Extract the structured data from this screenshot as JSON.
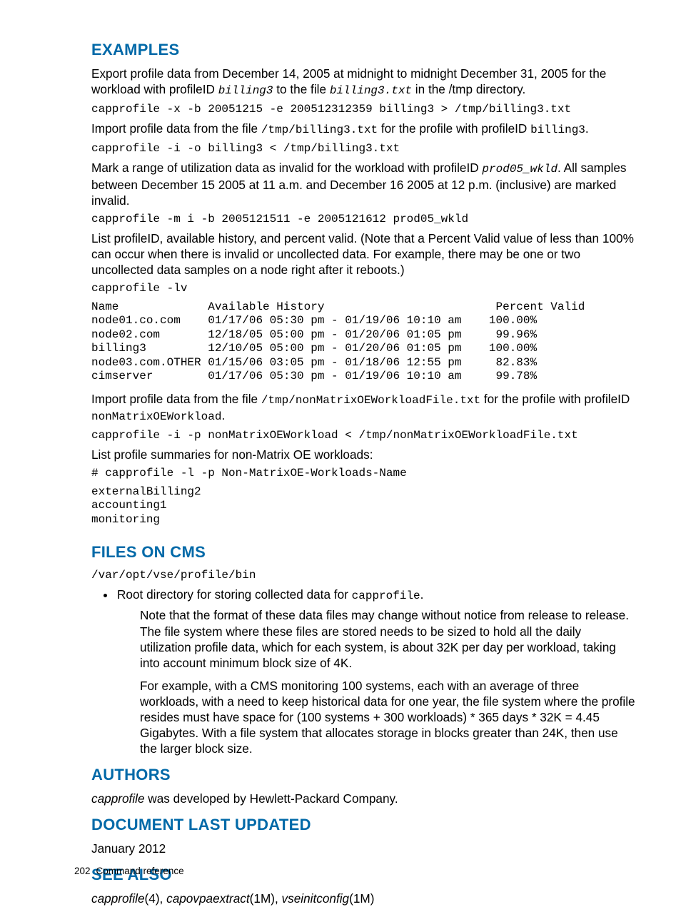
{
  "sections": {
    "examples": {
      "title": "EXAMPLES",
      "p1a": "Export profile data from December 14, 2005 at midnight to midnight December 31, 2005 for the workload with profileID ",
      "p1code1": "billing3",
      "p1b": " to the file ",
      "p1code2": "billing3.txt",
      "p1c": " in the /tmp directory.",
      "cmd1": "capprofile -x -b 20051215 -e 200512312359 billing3 > /tmp/billing3.txt",
      "p2a": "Import profile data from the file ",
      "p2code1": "/tmp/billing3.txt",
      "p2b": " for the profile with profileID ",
      "p2code2": "billing3",
      "p2c": ".",
      "cmd2": "capprofile -i -o billing3 < /tmp/billing3.txt",
      "p3a": "Mark a range of utilization data as invalid for the workload with profileID ",
      "p3code1": "prod05_wkld",
      "p3b": ". All samples between December 15 2005 at 11 a.m. and December 16 2005 at 12 p.m. (inclusive) are marked invalid.",
      "cmd3": "capprofile -m i -b 2005121511 -e 2005121612 prod05_wkld",
      "p4": "List profileID, available history, and percent valid. (Note that a Percent Valid value of less than 100% can occur when there is invalid or uncollected data. For example, there may be one or two uncollected data samples on a node right after it reboots.)",
      "cmd4": "capprofile -lv",
      "table": "Name             Available History                         Percent Valid\nnode01.co.com    01/17/06 05:30 pm - 01/19/06 10:10 am    100.00%\nnode02.com       12/18/05 05:00 pm - 01/20/06 01:05 pm     99.96%\nbilling3         12/10/05 05:00 pm - 01/20/06 01:05 pm    100.00%\nnode03.com.OTHER 01/15/06 03:05 pm - 01/18/06 12:55 pm     82.83%\ncimserver        01/17/06 05:30 pm - 01/19/06 10:10 am     99.78%",
      "p5a": "Import profile data from the file ",
      "p5code1": "/tmp/nonMatrixOEWorkloadFile.txt",
      "p5b": " for the profile with profileID ",
      "p5code2": "nonMatrixOEWorkload",
      "p5c": ".",
      "cmd5": "capprofile -i -p nonMatrixOEWorkload < /tmp/nonMatrixOEWorkloadFile.txt",
      "p6": "List profile summaries for non-Matrix OE workloads:",
      "cmd6": "# capprofile -l -p Non-MatrixOE-Workloads-Name",
      "out6": "externalBilling2\naccounting1\nmonitoring"
    },
    "files": {
      "title": "FILES ON CMS",
      "path": "/var/opt/vse/profile/bin",
      "li1a": "Root directory for storing collected data for ",
      "li1code": "capprofile",
      "li1b": ".",
      "sub1": "Note that the format of these data files may change without notice from release to release. The file system where these files are stored needs to be sized to hold all the daily utilization profile data, which for each system, is about 32K per day per workload, taking into account minimum block size of 4K.",
      "sub2": "For example, with a CMS monitoring 100 systems, each with an average of three workloads, with a need to keep historical data for one year, the file system where the profile resides must have space for (100 systems + 300 workloads) * 365 days * 32K = 4.45 Gigabytes. With a file system that allocates storage in blocks greater than 24K, then use the larger block size."
    },
    "authors": {
      "title": "AUTHORS",
      "texta": "capprofile",
      "textb": " was developed by Hewlett-Packard Company."
    },
    "updated": {
      "title": "DOCUMENT LAST UPDATED",
      "text": "January 2012"
    },
    "seealso": {
      "title": "SEE ALSO",
      "a1": "capprofile",
      "a1n": "(4), ",
      "a2": "capovpaextract",
      "a2n": "(1M), ",
      "a3": "vseinitconfig",
      "a3n": "(1M)"
    }
  },
  "footer": {
    "page": "202",
    "label": "Command reference"
  }
}
